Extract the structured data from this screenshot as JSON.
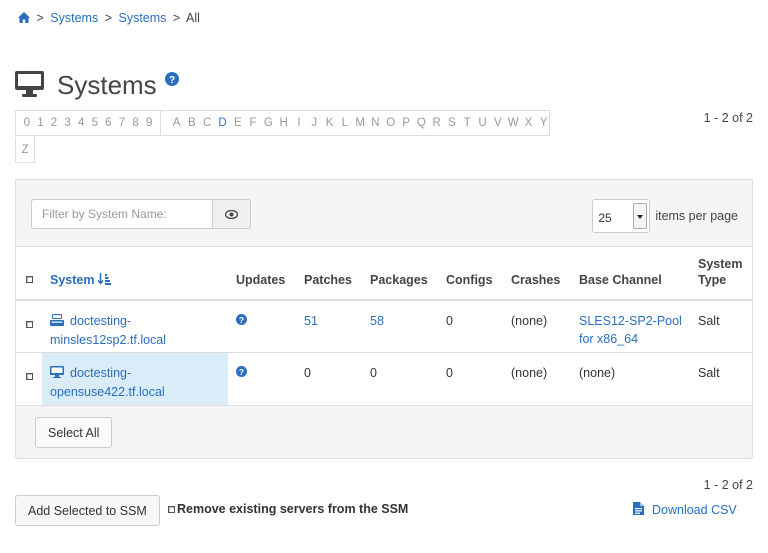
{
  "breadcrumb": {
    "items": [
      "Systems",
      "Systems",
      "All"
    ],
    "separator": ">"
  },
  "page": {
    "title": "Systems"
  },
  "alphabar": {
    "digits": [
      "0",
      "1",
      "2",
      "3",
      "4",
      "5",
      "6",
      "7",
      "8",
      "9"
    ],
    "letters": [
      "A",
      "B",
      "C",
      "D",
      "E",
      "F",
      "G",
      "H",
      "I",
      "J",
      "K",
      "L",
      "M",
      "N",
      "O",
      "P",
      "Q",
      "R",
      "S",
      "T",
      "U",
      "V",
      "W",
      "X",
      "Y"
    ],
    "active_letter": "D",
    "overflow_letter": "Z"
  },
  "pagination": {
    "top": "1 - 2 of 2",
    "bottom": "1 - 2 of 2"
  },
  "filter": {
    "placeholder": "Filter by System Name:"
  },
  "per_page": {
    "value": "25",
    "label": "items per page"
  },
  "table": {
    "columns": [
      "System",
      "Updates",
      "Patches",
      "Packages",
      "Configs",
      "Crashes",
      "Base Channel",
      "System Type"
    ],
    "rows": [
      {
        "system": "doctesting-minsles12sp2.tf.local",
        "system_icon": "server-icon",
        "patches": "51",
        "packages": "58",
        "configs": "0",
        "crashes": "(none)",
        "base_channel": "SLES12-SP2-Pool for x86_64",
        "system_type": "Salt",
        "selected": false
      },
      {
        "system": "doctesting-opensuse422.tf.local",
        "system_icon": "desktop-icon",
        "patches": "0",
        "packages": "0",
        "configs": "0",
        "crashes": "(none)",
        "base_channel": "(none)",
        "system_type": "Salt",
        "selected": true
      }
    ]
  },
  "buttons": {
    "select_all": "Select All",
    "add_ssm": "Add Selected to SSM",
    "remove_ssm": "Remove existing servers from the SSM",
    "download_csv": "Download CSV"
  },
  "colors": {
    "link": "#2a6fbd",
    "selected_row": "#d9ecf7",
    "panel_bg": "#f5f5f5",
    "border": "#dddddd"
  }
}
